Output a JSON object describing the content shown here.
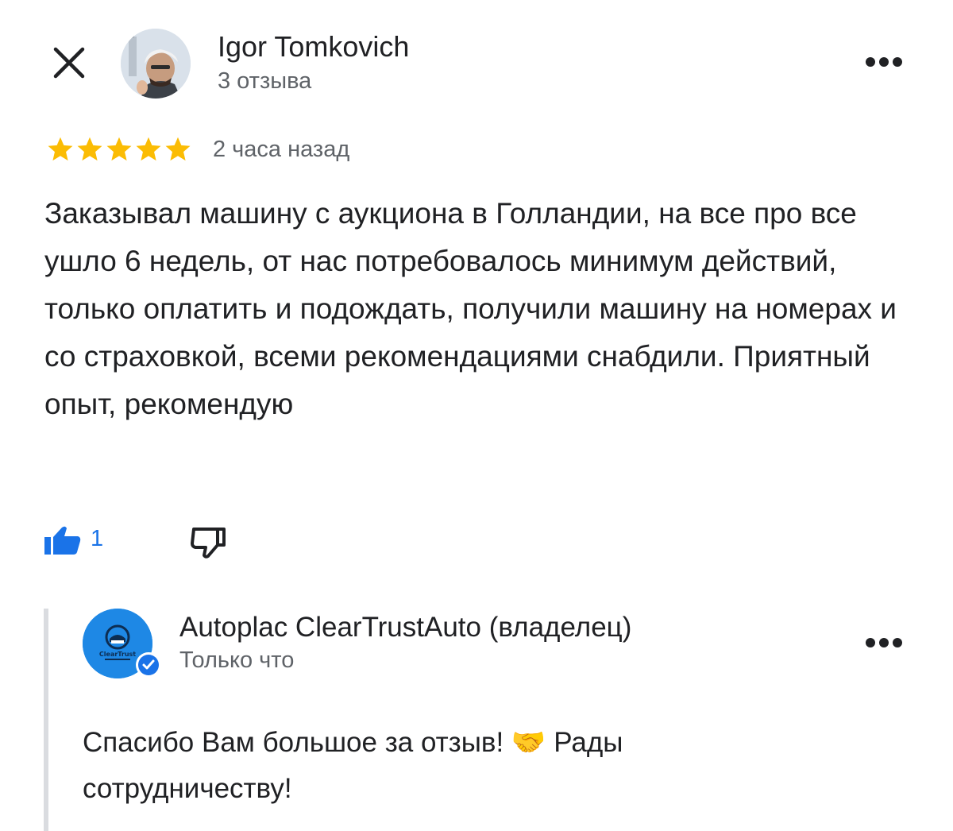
{
  "reviewer": {
    "name": "Igor Tomkovich",
    "review_count": "3 отзыва"
  },
  "review": {
    "rating": 5,
    "time": "2 часа назад",
    "text": "Заказывал машину с аукциона в Голландии, на все про все ушло 6 недель, от нас потребовалось минимум действий, только оплатить и подождать, получили машину на номерах и со страховкой, всеми рекомендациями снабдили. Приятный опыт, рекомендую",
    "likes": "1"
  },
  "owner_reply": {
    "name": "Autoplac ClearTrustAuto (владелец)",
    "time": "Только что",
    "text": "Спасибо Вам большое за отзыв! 🤝 Рады сотрудничеству!",
    "logo_text": "ClearTrust"
  },
  "icons": {
    "close": "close-icon",
    "more": "more-horizontal-icon",
    "star": "star-icon",
    "like": "thumb-up-icon",
    "dislike": "thumb-down-icon",
    "verified": "verified-badge-icon"
  },
  "colors": {
    "star": "#fbbc04",
    "like": "#1a73e8",
    "verified": "#1a73e8",
    "owner_avatar": "#1e88e5"
  }
}
